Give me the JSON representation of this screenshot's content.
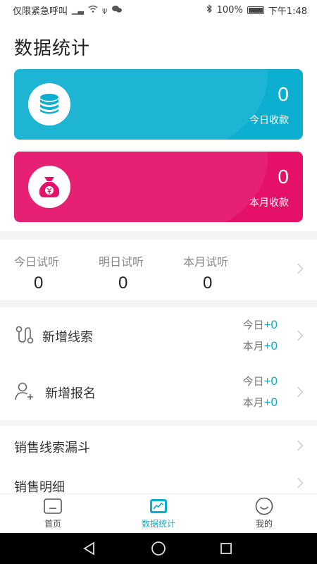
{
  "status_bar": {
    "left_text": "仅限紧急呼叫",
    "battery_text": "100%",
    "time": "下午1:48"
  },
  "header": {
    "title": "数据统计"
  },
  "cards": [
    {
      "value": "0",
      "label": "今日收款",
      "color": "#0dafd0",
      "icon": "coin-stack-icon"
    },
    {
      "value": "0",
      "label": "本月收款",
      "color": "#e51169",
      "icon": "money-bag-icon"
    }
  ],
  "trial": {
    "items": [
      {
        "label": "今日试听",
        "value": "0"
      },
      {
        "label": "明日试听",
        "value": "0"
      },
      {
        "label": "本月试听",
        "value": "0"
      }
    ]
  },
  "metrics": [
    {
      "label": "新增线索",
      "icon": "route-icon",
      "today_label": "今日",
      "today_value": "+0",
      "month_label": "本月",
      "month_value": "+0"
    },
    {
      "label": "新增报名",
      "icon": "add-user-icon",
      "today_label": "今日",
      "today_value": "+0",
      "month_label": "本月",
      "month_value": "+0"
    }
  ],
  "links": [
    {
      "label": "销售线索漏斗"
    },
    {
      "label": "销售明细"
    }
  ],
  "tabbar": {
    "items": [
      {
        "label": "首页",
        "icon": "home-icon"
      },
      {
        "label": "数据统计",
        "icon": "chart-icon",
        "active": true
      },
      {
        "label": "我的",
        "icon": "smile-icon"
      }
    ]
  },
  "colors": {
    "accent": "#0aaecb",
    "card_blue": "#0dafd0",
    "card_pink": "#e51169"
  }
}
